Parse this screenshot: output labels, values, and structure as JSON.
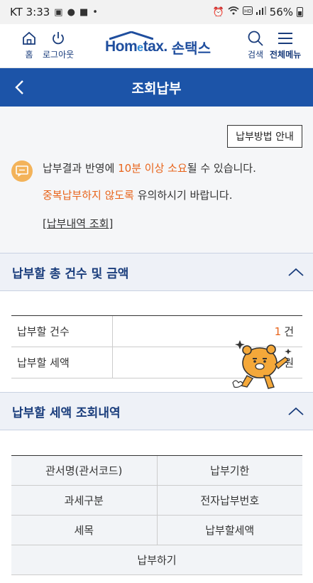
{
  "status_bar": {
    "carrier_time": "KT 3:33",
    "battery": "56%"
  },
  "header": {
    "home_label": "홈",
    "logout_label": "로그아웃",
    "logo_en": "Hometax.",
    "logo_en_main": "Hom",
    "logo_en_e": "e",
    "logo_en_tail": "tax.",
    "logo_kr": "손택스",
    "search_label": "검색",
    "menu_label": "전체메뉴"
  },
  "title_bar": {
    "title": "조회납부"
  },
  "payment_method_button": "납부방법 안내",
  "notice": {
    "line1_prefix": "납부결과 반영에 ",
    "line1_highlight": "10분 이상 소요",
    "line1_suffix": "될 수 있습니다.",
    "line2_highlight": "중복납부하지 않도록",
    "line2_suffix": " 유의하시기 바랍니다.",
    "link_open": "[",
    "link_text": "납부내역 조회",
    "link_close": "]"
  },
  "summary_section": {
    "title": "납부할 총 건수 및 금액",
    "rows": [
      {
        "label": "납부할 건수",
        "value": "1",
        "unit": "건"
      },
      {
        "label": "납부할 세액",
        "value": "",
        "unit": "원"
      }
    ]
  },
  "detail_section": {
    "title": "납부할 세액 조회내역",
    "rows": [
      [
        "관서명(관서코드)",
        "납부기한"
      ],
      [
        "과세구분",
        "전자납부번호"
      ],
      [
        "세목",
        "납부할세액"
      ],
      [
        "납부하기"
      ]
    ]
  },
  "colors": {
    "primary": "#1c54a8",
    "accent_orange": "#e8641b",
    "section_bg": "#eef1f7"
  }
}
